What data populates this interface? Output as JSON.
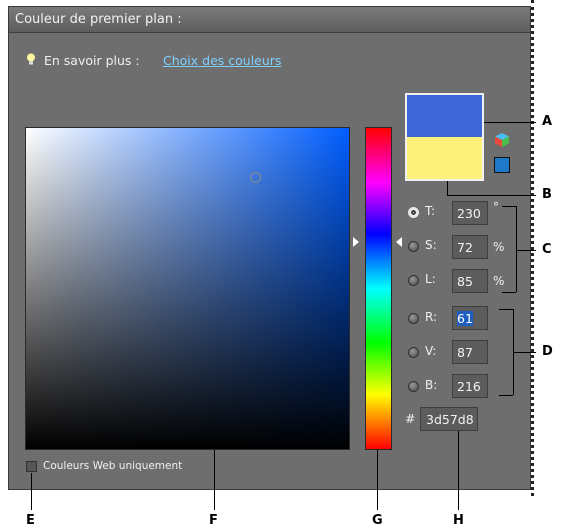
{
  "dialog": {
    "title": "Couleur de premier plan :",
    "learn_more_label": "En savoir plus :",
    "learn_more_link": "Choix des couleurs",
    "hsl": {
      "h_label": "T:",
      "h_value": "230",
      "h_unit": "°",
      "s_label": "S:",
      "s_value": "72",
      "s_unit": "%",
      "l_label": "L:",
      "l_value": "85",
      "l_unit": "%"
    },
    "rgb": {
      "r_label": "R:",
      "r_value": "61",
      "g_label": "V:",
      "g_value": "87",
      "b_label": "B:",
      "b_value": "216"
    },
    "hex_label": "#",
    "hex_value": "3d57d8",
    "web_colors_label": "Couleurs Web uniquement",
    "new_color": "#3d67d8",
    "old_color": "#fdf07b"
  },
  "callouts": {
    "a": "A",
    "b": "B",
    "c": "C",
    "d": "D",
    "e": "E",
    "f": "F",
    "g": "G",
    "h": "H"
  }
}
